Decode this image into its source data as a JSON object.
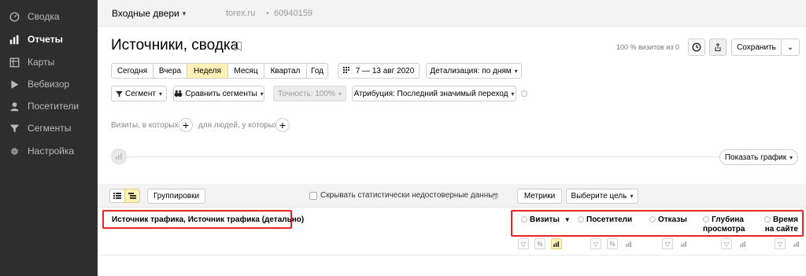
{
  "sidebar": {
    "items": [
      {
        "label": "Сводка",
        "icon": "speedometer-icon",
        "active": false
      },
      {
        "label": "Отчеты",
        "icon": "bar-chart-icon",
        "active": true
      },
      {
        "label": "Карты",
        "icon": "map-icon",
        "active": false
      },
      {
        "label": "Вебвизор",
        "icon": "play-icon",
        "active": false
      },
      {
        "label": "Посетители",
        "icon": "user-icon",
        "active": false
      },
      {
        "label": "Сегменты",
        "icon": "filter-icon",
        "active": false
      },
      {
        "label": "Настройка",
        "icon": "gear-icon",
        "active": false
      }
    ]
  },
  "topbar": {
    "counter_name": "Входные двери",
    "domain": "torex.ru",
    "separator": "•",
    "counter_id": "60940159"
  },
  "header": {
    "title": "Источники, сводка",
    "sample_text": "100 % визитов из 0",
    "save_label": "Сохранить"
  },
  "period": {
    "options": [
      "Сегодня",
      "Вчера",
      "Неделя",
      "Месяц",
      "Квартал",
      "Год"
    ],
    "selected": "Неделя",
    "date_range": "7 — 13 авг 2020",
    "detail": "Детализация: по дням"
  },
  "filters": {
    "segment": "Сегмент",
    "compare": "Сравнить сегменты",
    "accuracy": "Точность: 100%",
    "attribution": "Атрибуция: Последний значимый переход"
  },
  "segment_builder": {
    "visits_hint": "Визиты, в которых",
    "people_hint": "для людей, у которых"
  },
  "chart_toggle": {
    "label": "Показать график"
  },
  "table": {
    "groupings_label": "Группировки",
    "hide_unreliable_label": "Скрывать статистически недостоверные данные",
    "metrics_label": "Метрики",
    "goal_label": "Выберите цель",
    "dimension_title": "Источник трафика, Источник трафика (детально)",
    "metrics": [
      {
        "label": "Визиты",
        "sorted": true,
        "sort_arrow": "▼"
      },
      {
        "label": "Посетители"
      },
      {
        "label": "Отказы"
      },
      {
        "label": "Глубина просмотра",
        "line1": "Глубина",
        "line2": "просмотра"
      },
      {
        "label": "Время на сайте",
        "line1": "Время",
        "line2": "на сайте"
      }
    ]
  },
  "colors": {
    "sidebar_bg": "#2e2e2e",
    "accent_yellow": "#fff1b8",
    "highlight_red": "#e8232a"
  }
}
